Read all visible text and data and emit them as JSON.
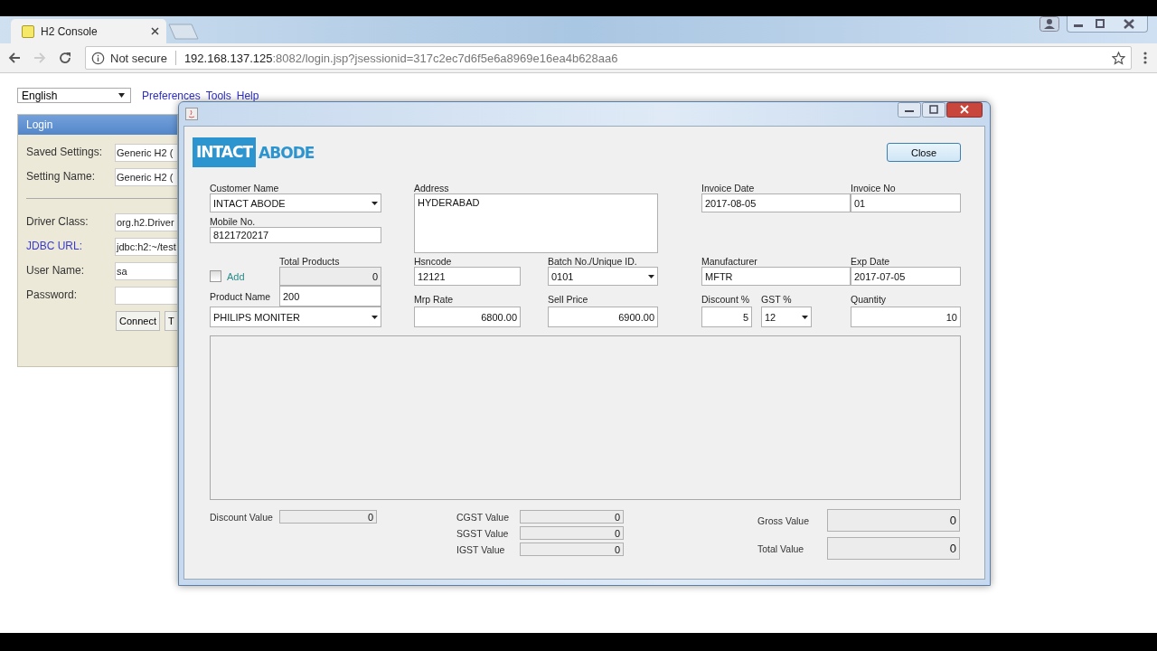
{
  "browser": {
    "tab_title": "H2 Console",
    "security": "Not secure",
    "url_host": "192.168.137.125",
    "url_rest": ":8082/login.jsp?jsessionid=317c2ec7d6f5e6a8969e16ea4b628aa6",
    "forward_disabled": true
  },
  "page": {
    "language": "English",
    "menu_links": [
      "Preferences",
      "Tools",
      "Help"
    ],
    "login": {
      "title": "Login",
      "settings_fields": [
        {
          "label": "Saved Settings:",
          "value": "Generic H2 (",
          "link": false
        },
        {
          "label": "Setting Name:",
          "value": "Generic H2 (",
          "link": false
        }
      ],
      "connection_fields": [
        {
          "label": "Driver Class:",
          "value": "org.h2.Driver",
          "link": false
        },
        {
          "label": "JDBC URL:",
          "value": "jdbc:h2:~/test",
          "link": true
        },
        {
          "label": "User Name:",
          "value": "sa",
          "link": false
        },
        {
          "label": "Password:",
          "link": false
        }
      ],
      "buttons": [
        "Connect",
        "T"
      ]
    }
  },
  "dialog": {
    "logo_left": "INTACT",
    "logo_right": "ABODE",
    "close_button": "Close",
    "customer_name": {
      "label": "Customer Name",
      "value": "INTACT ABODE"
    },
    "mobile": {
      "label": "Mobile No.",
      "value": "8121720217"
    },
    "address": {
      "label": "Address",
      "value": "HYDERABAD"
    },
    "invoice_date": {
      "label": "Invoice Date",
      "value": "2017-08-05"
    },
    "invoice_no": {
      "label": "Invoice No",
      "value": "01"
    },
    "add": {
      "label": "Add",
      "checked": false
    },
    "total_products": {
      "label": "Total Products",
      "value": "0",
      "disabled": true
    },
    "hsncode": {
      "label": "Hsncode",
      "value": "12121"
    },
    "batch": {
      "label": "Batch No./Unique ID.",
      "value": "0101"
    },
    "manufacturer": {
      "label": "Manufacturer",
      "value": "MFTR"
    },
    "exp_date": {
      "label": "Exp Date",
      "value": "2017-07-05"
    },
    "product_name": {
      "label": "Product Name",
      "value": "PHILIPS MONITER"
    },
    "product_field": {
      "value": "200"
    },
    "mrp_rate": {
      "label": "Mrp Rate",
      "value": "6800.00"
    },
    "sell_price": {
      "label": "Sell Price",
      "value": "6900.00"
    },
    "discount_pct": {
      "label": "Discount %",
      "value": "5"
    },
    "gst_pct": {
      "label": "GST %",
      "value": "12"
    },
    "quantity": {
      "label": "Quantity",
      "value": "10"
    },
    "discount_value": {
      "label": "Discount Value",
      "value": "0",
      "disabled": true
    },
    "tax_values": [
      {
        "label": "CGST Value",
        "value": "0",
        "disabled": true
      },
      {
        "label": "SGST Value",
        "value": "0",
        "disabled": true
      },
      {
        "label": "IGST Value",
        "value": "0",
        "disabled": true
      }
    ],
    "totals": [
      {
        "label": "Gross Value",
        "value": "0",
        "disabled": true
      },
      {
        "label": "Total Value",
        "value": "0",
        "disabled": true
      }
    ]
  }
}
